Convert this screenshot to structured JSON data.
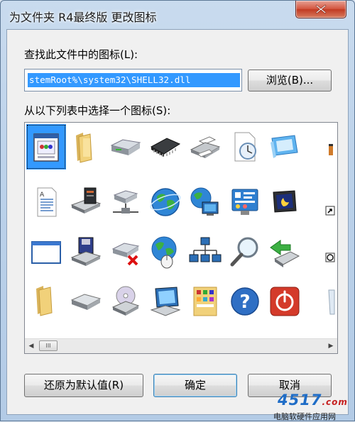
{
  "window": {
    "title": "为文件夹 R4最终版 更改图标"
  },
  "file_search": {
    "label": "查找此文件中的图标(L):",
    "path_value": "stemRoot%\\system32\\SHELL32.dll",
    "browse_label": "浏览(B)..."
  },
  "icon_picker": {
    "label": "从以下列表中选择一个图标(S):",
    "icons": [
      [
        "window-app-icon",
        "folder-icon",
        "drive-icon",
        "memory-chip-icon",
        "printer-icon",
        "clock-document-icon",
        "monitor-window-icon",
        "partial-icon"
      ],
      [
        "text-document-icon",
        "desktop-computer-icon",
        "network-drive-icon",
        "globe-icon",
        "network-computer-icon",
        "control-panel-icon",
        "monitor-moon-icon",
        "shortcut-overlay-icon"
      ],
      [
        "blank-window-icon",
        "floppy-drive-icon",
        "disconnected-drive-icon",
        "globe-mouse-icon",
        "network-tree-icon",
        "search-magnifier-icon",
        "usb-arrow-icon",
        "shortcut-clock-icon"
      ],
      [
        "folder-icon",
        "hard-disk-icon",
        "cd-drive-icon",
        "computer-screen-icon",
        "folder-panel-icon",
        "help-icon",
        "power-icon",
        "recycle-bin-icon"
      ]
    ],
    "selected_index": "0"
  },
  "scrollbar": {
    "thumb_grip": "III"
  },
  "buttons": {
    "restore_default": "还原为默认值(R)",
    "ok": "确定",
    "cancel": "取消"
  },
  "watermark": {
    "logo": "4517",
    "logo_suffix": ".com",
    "text": "电脑软硬件应用网"
  }
}
